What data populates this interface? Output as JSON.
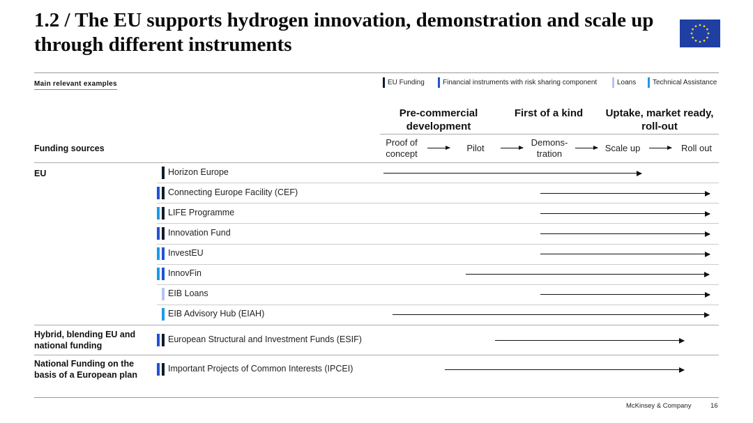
{
  "title": "1.2 / The EU supports hydrogen innovation, demonstration and scale up through different instruments",
  "flag_icon": "eu-flag",
  "main_examples_label": "Main relevant examples",
  "legend": [
    {
      "key": "eu",
      "label": "EU Funding",
      "color": "#0d1c2e"
    },
    {
      "key": "fin",
      "label": "Financial instruments with risk sharing component",
      "color": "#2350d6"
    },
    {
      "key": "loan",
      "label": "Loans",
      "color": "#b6c4ee"
    },
    {
      "key": "ta",
      "label": "Technical Assistance",
      "color": "#1d9be6"
    }
  ],
  "stages": [
    "Pre-commercial development",
    "First of a kind",
    "Uptake, market ready, roll-out"
  ],
  "steps": [
    "Proof of concept",
    "Pilot",
    "Demons-tration",
    "Scale up",
    "Roll out"
  ],
  "funding_sources_label": "Funding sources",
  "sections": [
    {
      "label": "EU",
      "rows": [
        {
          "name": "Horizon Europe",
          "types": [
            "eu"
          ],
          "from": "Proof of concept",
          "to": "Scale up"
        },
        {
          "name": "Connecting Europe Facility (CEF)",
          "types": [
            "fin",
            "eu"
          ],
          "from": "Demonstration",
          "to": "Roll out"
        },
        {
          "name": "LIFE Programme",
          "types": [
            "ta",
            "eu"
          ],
          "from": "Demonstration",
          "to": "Roll out"
        },
        {
          "name": "Innovation Fund",
          "types": [
            "fin",
            "eu"
          ],
          "from": "Demonstration",
          "to": "Roll out"
        },
        {
          "name": "InvestEU",
          "types": [
            "ta",
            "fin"
          ],
          "from": "Demonstration",
          "to": "Roll out"
        },
        {
          "name": "InnovFin",
          "types": [
            "ta",
            "fin"
          ],
          "from": "Pilot",
          "to": "Roll out"
        },
        {
          "name": "EIB Loans",
          "types": [
            "loan"
          ],
          "from": "Demonstration",
          "to": "Roll out"
        },
        {
          "name": "EIB Advisory Hub (EIAH)",
          "types": [
            "ta"
          ],
          "from": "Proof of concept",
          "to": "Roll out"
        }
      ]
    },
    {
      "label": "Hybrid, blending EU and national funding",
      "rows": [
        {
          "name": "European Structural and Investment Funds (ESIF)",
          "types": [
            "fin",
            "eu"
          ],
          "from": "Pilot",
          "to": "Roll out"
        }
      ]
    },
    {
      "label": "National Funding on the basis of a European plan",
      "rows": [
        {
          "name": "Important Projects of Common Interests (IPCEI)",
          "types": [
            "fin",
            "eu"
          ],
          "from": "Pilot",
          "to": "Roll out"
        }
      ]
    }
  ],
  "footer": {
    "company": "McKinsey & Company",
    "page": "16"
  }
}
